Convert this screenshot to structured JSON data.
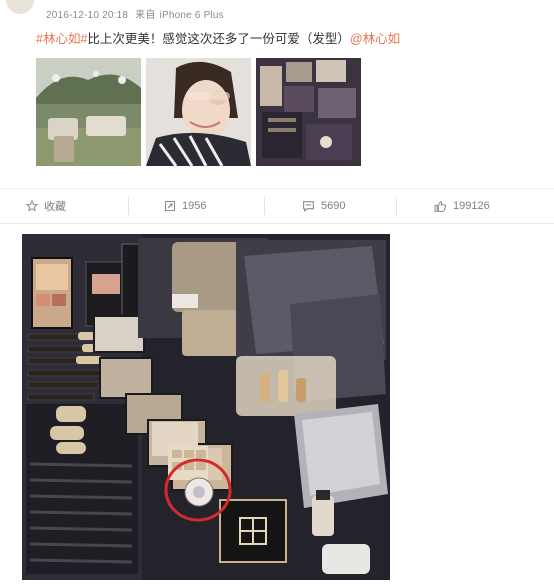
{
  "post": {
    "timestamp": "2016-12-10 20:18",
    "source_prefix": "来自",
    "source": "iPhone 6 Plus",
    "text_tag": "#林心如#",
    "text_body": "比上次更美！感觉这次还多了一份可爱（发型）",
    "text_mention": "@林心如"
  },
  "thumbnails": [
    {
      "icon": "garden-wedding-photo"
    },
    {
      "icon": "selfie-photo"
    },
    {
      "icon": "makeup-table-photo"
    }
  ],
  "actions": {
    "favorite_label": "收藏",
    "repost_count": "1956",
    "comment_count": "5690",
    "like_count": "199126"
  },
  "colors": {
    "tag": "#eb7350",
    "meta": "#8b8b8b",
    "circle_highlight": "#d42a2a"
  }
}
